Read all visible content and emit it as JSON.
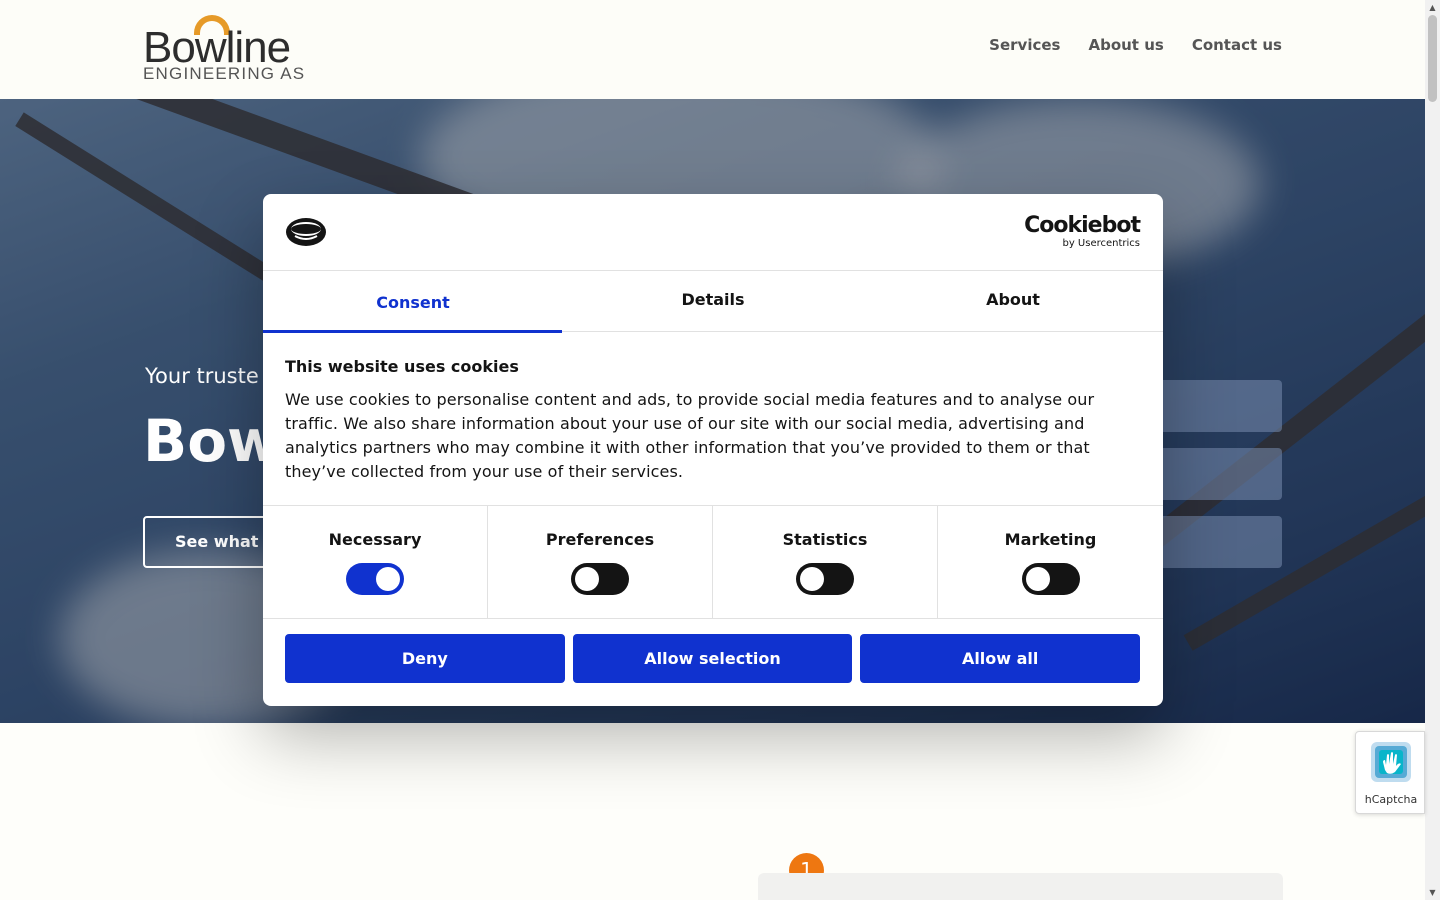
{
  "header": {
    "logo_word": "Bowline",
    "logo_sub": "ENGINEERING AS",
    "nav": [
      "Services",
      "About us",
      "Contact us"
    ]
  },
  "hero": {
    "kicker": "Your truste",
    "title": "Bow",
    "button_label": "See what w"
  },
  "section": {
    "step_badge": "1"
  },
  "cookie_dialog": {
    "brand_main": "Cookiebot",
    "brand_sub": "by Usercentrics",
    "tabs": [
      "Consent",
      "Details",
      "About"
    ],
    "active_tab": "Consent",
    "heading": "This website uses cookies",
    "body": "We use cookies to personalise content and ads, to provide social media features and to analyse our traffic. We also share information about your use of our site with our social media, advertising and analytics partners who may combine it with other information that you’ve provided to them or that they’ve collected from your use of their services.",
    "categories": [
      {
        "label": "Necessary",
        "enabled": true
      },
      {
        "label": "Preferences",
        "enabled": false
      },
      {
        "label": "Statistics",
        "enabled": false
      },
      {
        "label": "Marketing",
        "enabled": false
      }
    ],
    "buttons": {
      "deny": "Deny",
      "allow_selection": "Allow selection",
      "allow_all": "Allow all"
    }
  },
  "hcaptcha": {
    "label": "hCaptcha"
  },
  "colors": {
    "accent": "#1032cf",
    "logo_orange": "#e69a28",
    "badge_orange": "#ee7711"
  }
}
